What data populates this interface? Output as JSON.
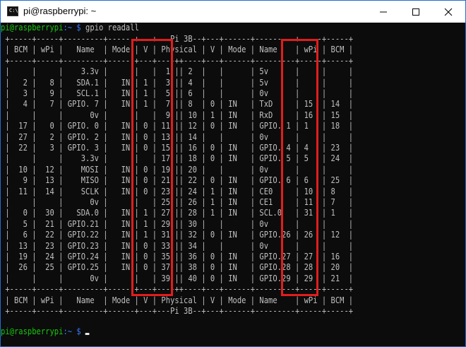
{
  "window": {
    "title": "pi@raspberrypi: ~"
  },
  "terminal": {
    "prompt1": {
      "user": "pi@raspberrypi",
      "path": ":~ $",
      "command": " gpio readall"
    },
    "table_lines": [
      " +-----+-----+---------+------+---+---Pi 3B--+---+------+---------+-----+-----+",
      " | BCM | wPi |   Name  | Mode | V | Physical | V | Mode | Name    | wPi | BCM |",
      " +-----+-----+---------+------+---+----++----+---+------+---------+-----+-----+",
      " |     |     |    3.3v |      |   |  1 || 2  |   |      | 5v      |     |     |",
      " |   2 |   8 |   SDA.1 |   IN | 1 |  3 || 4  |   |      | 5v      |     |     |",
      " |   3 |   9 |   SCL.1 |   IN | 1 |  5 || 6  |   |      | 0v      |     |     |",
      " |   4 |   7 | GPIO. 7 |   IN | 1 |  7 || 8  | 0 | IN   | TxD     | 15  | 14  |",
      " |     |     |      0v |      |   |  9 || 10 | 1 | IN   | RxD     | 16  | 15  |",
      " |  17 |   0 | GPIO. 0 |   IN | 0 | 11 || 12 | 0 | IN   | GPIO. 1 | 1   | 18  |",
      " |  27 |   2 | GPIO. 2 |   IN | 0 | 13 || 14 |   |      | 0v      |     |     |",
      " |  22 |   3 | GPIO. 3 |   IN | 0 | 15 || 16 | 0 | IN   | GPIO. 4 | 4   | 23  |",
      " |     |     |    3.3v |      |   | 17 || 18 | 0 | IN   | GPIO. 5 | 5   | 24  |",
      " |  10 |  12 |    MOSI |   IN | 0 | 19 || 20 |   |      | 0v      |     |     |",
      " |   9 |  13 |    MISO |   IN | 0 | 21 || 22 | 0 | IN   | GPIO. 6 | 6   | 25  |",
      " |  11 |  14 |    SCLK |   IN | 0 | 23 || 24 | 1 | IN   | CE0     | 10  | 8   |",
      " |     |     |      0v |      |   | 25 || 26 | 1 | IN   | CE1     | 11  | 7   |",
      " |   0 |  30 |   SDA.0 |   IN | 1 | 27 || 28 | 1 | IN   | SCL.0   | 31  | 1   |",
      " |   5 |  21 | GPIO.21 |   IN | 1 | 29 || 30 |   |      | 0v      |     |     |",
      " |   6 |  22 | GPIO.22 |   IN | 1 | 31 || 32 | 0 | IN   | GPIO.26 | 26  | 12  |",
      " |  13 |  23 | GPIO.23 |   IN | 0 | 33 || 34 |   |      | 0v      |     |     |",
      " |  19 |  24 | GPIO.24 |   IN | 0 | 35 || 36 | 0 | IN   | GPIO.27 | 27  | 16  |",
      " |  26 |  25 | GPIO.25 |   IN | 0 | 37 || 38 | 0 | IN   | GPIO.28 | 28  | 20  |",
      " |     |     |      0v |      |   | 39 || 40 | 0 | IN   | GPIO.29 | 29  | 21  |",
      " +-----+-----+---------+------+---+----++----+---+------+---------+-----+-----+",
      " | BCM | wPi |   Name  | Mode | V | Physical | V | Mode | Name    | wPi | BCM |",
      " +-----+-----+---------+------+---+---Pi 3B--+---+------+---------+-----+-----+"
    ],
    "prompt2": {
      "user": "pi@raspberrypi",
      "path": ":~ $",
      "command": " "
    }
  },
  "colors": {
    "highlight": "#e21d1d",
    "prompt_user": "#16c60c",
    "prompt_path": "#3b78ff"
  },
  "icons": {
    "app": "terminal-icon",
    "minimize": "minimize-icon",
    "maximize": "maximize-icon",
    "close": "close-icon"
  }
}
